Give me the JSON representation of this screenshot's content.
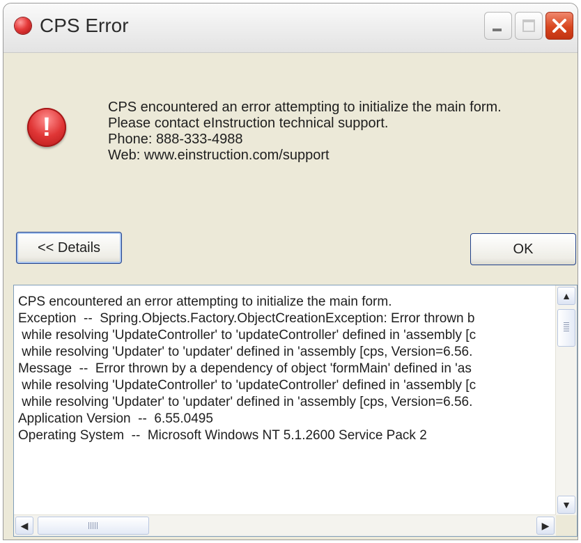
{
  "window": {
    "title": "CPS Error"
  },
  "message": {
    "lines": [
      "CPS encountered an error attempting to initialize the main form.",
      "Please contact eInstruction technical support.",
      "Phone: 888-333-4988",
      "Web: www.einstruction.com/support"
    ]
  },
  "buttons": {
    "details_label": "<< Details",
    "ok_label": "OK"
  },
  "details": {
    "lines": [
      "CPS encountered an error attempting to initialize the main form.",
      "",
      "",
      "Exception  --  Spring.Objects.Factory.ObjectCreationException: Error thrown b",
      " while resolving 'UpdateController' to 'updateController' defined in 'assembly [c",
      " while resolving 'Updater' to 'updater' defined in 'assembly [cps, Version=6.56.",
      "Message  --  Error thrown by a dependency of object 'formMain' defined in 'as",
      " while resolving 'UpdateController' to 'updateController' defined in 'assembly [c",
      " while resolving 'Updater' to 'updater' defined in 'assembly [cps, Version=6.56.",
      "Application Version  --  6.55.0495",
      "Operating System  --  Microsoft Windows NT 5.1.2600 Service Pack 2"
    ]
  },
  "icons": {
    "title": "app-orb-icon",
    "error": "error-icon",
    "scroll_up": "▲",
    "scroll_down": "▼",
    "scroll_left": "◀",
    "scroll_right": "▶"
  }
}
